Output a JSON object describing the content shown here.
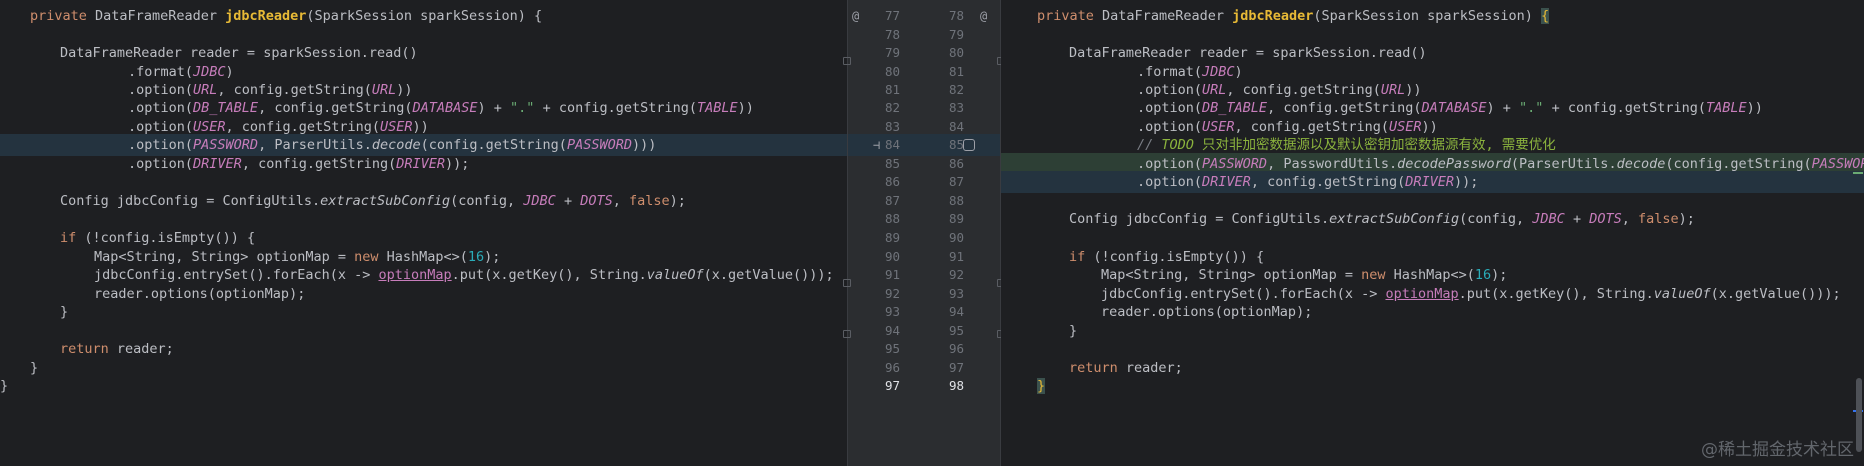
{
  "left_pane": {
    "lines": [
      {
        "html_key": "sig"
      },
      {
        "html_key": "blank"
      },
      {
        "html_key": "reader"
      },
      {
        "html_key": "format"
      },
      {
        "html_key": "url"
      },
      {
        "html_key": "dbtable"
      },
      {
        "html_key": "user"
      },
      {
        "html_key": "password_old"
      },
      {
        "html_key": "driver"
      },
      {
        "html_key": "blank"
      },
      {
        "html_key": "config"
      },
      {
        "html_key": "blank"
      },
      {
        "html_key": "if"
      },
      {
        "html_key": "map"
      },
      {
        "html_key": "foreach"
      },
      {
        "html_key": "options"
      },
      {
        "html_key": "close_if"
      },
      {
        "html_key": "blank"
      },
      {
        "html_key": "return"
      },
      {
        "html_key": "close_method"
      },
      {
        "html_key": "close_class"
      }
    ]
  },
  "gutter": {
    "left_numbers": [
      "77",
      "78",
      "79",
      "80",
      "81",
      "82",
      "83",
      "84",
      "85",
      "86",
      "87",
      "88",
      "89",
      "90",
      "91",
      "92",
      "93",
      "94",
      "95",
      "96",
      "97"
    ],
    "right_numbers": [
      "78",
      "79",
      "80",
      "81",
      "82",
      "83",
      "84",
      "85",
      "86",
      "87",
      "88",
      "89",
      "90",
      "91",
      "92",
      "93",
      "94",
      "95",
      "96",
      "97",
      "98"
    ],
    "left_current": "97",
    "right_current": "98",
    "override_icon": "@"
  },
  "text": {
    "kw_private": "private",
    "type_dfr": "DataFrameReader",
    "method_name": "jdbcReader",
    "param": "(SparkSession sparkSession) ",
    "open_brace": "{",
    "reader_decl": "DataFrameReader reader = sparkSession.read()",
    "format_pre": ".format(",
    "c_jdbc": "JDBC",
    "close_paren": ")",
    "option_pre": ".option(",
    "c_url": "URL",
    "cfg_get": ", config.getString(",
    "close2": "))",
    "c_dbtable": "DB_TABLE",
    "c_database": "DATABASE",
    "plus": ") + ",
    "dot_str": "\".\"",
    "plus_cfg": " + config.getString(",
    "c_table": "TABLE",
    "c_user": "USER",
    "c_password": "PASSWORD",
    "parser_decode_pre": ", ParserUtils.",
    "decode": "decode",
    "decode_paren": "(config.getString(",
    "close3": ")))",
    "c_driver": "DRIVER",
    "close_semi": "));",
    "config_decl_pre": "Config jdbcConfig = ConfigUtils.",
    "extract": "extractSubConfig",
    "extract_args": "(config, ",
    "plus2": " + ",
    "c_dots": "DOTS",
    "comma": ", ",
    "kw_false": "false",
    "paren_semi": ");",
    "kw_if": "if",
    "if_cond": " (!config.isEmpty()) {",
    "map_decl": "Map<String, String> optionMap = ",
    "kw_new": "new",
    "hashmap": " HashMap<>(",
    "n16": "16",
    "foreach_pre": "jdbcConfig.entrySet().forEach(x -> ",
    "option_map": "optionMap",
    "foreach_mid": ".put(x.getKey(), String.",
    "value_of": "valueOf",
    "foreach_end": "(x.getValue()));",
    "options_call": "reader.options(optionMap);",
    "close_brace": "}",
    "kw_return": "return",
    "return_rest": " reader;",
    "todo_slashes": "// ",
    "todo_kw": "TODO",
    "todo_text": " 只对非加密数据源以及默认密钥加密数据源有效, 需要优化",
    "password_utils": ", PasswordUtils.",
    "decode_password": "decodePassword",
    "parser_paren": "(ParserUtils.",
    "cfg_paren": "(config.getString(",
    "right_pw_tail": "PASSWORD"
  },
  "watermark": "@稀土掘金技术社区",
  "colors": {
    "background": "#1e1f22",
    "gutter": "#2b2d30",
    "modified_line": "#24333f",
    "added_line": "#2d3f35",
    "keyword": "#cf8e6d",
    "method": "#e8ba36",
    "constant": "#c77dbb",
    "string": "#6aab73",
    "number": "#2aacb8",
    "todo": "#8bb33d"
  }
}
